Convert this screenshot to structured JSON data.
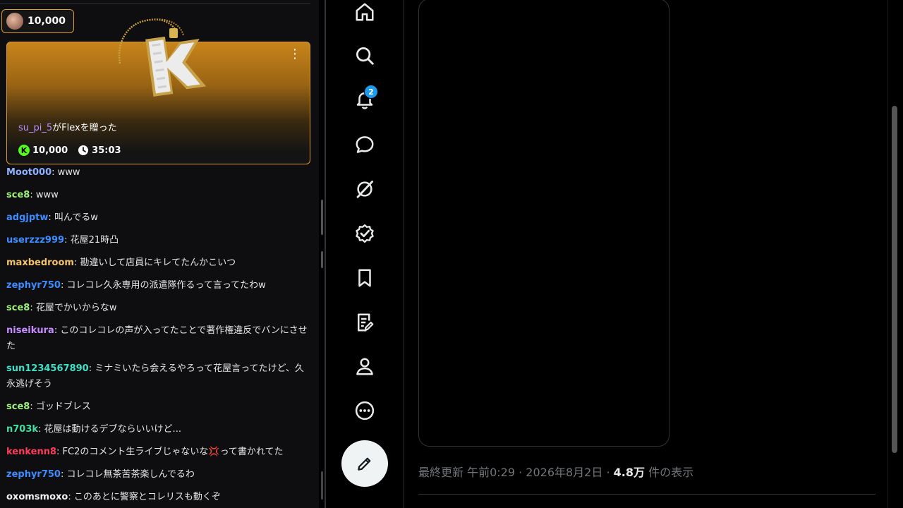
{
  "chat": {
    "gift_pill": {
      "amount": "10,000"
    },
    "flex_card": {
      "user": "su_pi_5",
      "message": "がFlexを贈った",
      "kick_amount": "10,000",
      "time_left": "35:03",
      "menu_glyph": "⋮"
    },
    "messages": [
      {
        "name": "Moot000",
        "text": ": www",
        "color": "#8fb1ff"
      },
      {
        "name": "sce8",
        "text": ": www",
        "color": "#9ef07a"
      },
      {
        "name": "adgjptw",
        "text": ": 叫んでるw",
        "color": "#3d8bff"
      },
      {
        "name": "userzzz999",
        "text": ": 花屋21時凸",
        "color": "#3d8bff"
      },
      {
        "name": "maxbedroom",
        "text": ": 勘違いして店員にキレてたんかこいつ",
        "color": "#f3c06a"
      },
      {
        "name": "zephyr750",
        "text": ": コレコレ久永専用の派遣隊作るって言ってたわw",
        "color": "#3d8bff"
      },
      {
        "name": "sce8",
        "text": ": 花屋でかいからなw",
        "color": "#9ef07a"
      },
      {
        "name": "niseikura",
        "text": ": このコレコレの声が入ってたことで著作権違反でバンにさせた",
        "color": "#c58cff"
      },
      {
        "name": "sun1234567890",
        "text": ": ミナミいたら会えるやろって花屋言ってたけど、久永逃げそう",
        "color": "#3fe0c5"
      },
      {
        "name": "sce8",
        "text": ": ゴッドブレス",
        "color": "#9ef07a"
      },
      {
        "name": "n703k",
        "text": ": 花屋は動けるデブならいいけど...",
        "color": "#3fe0a0"
      },
      {
        "name": "kenkenn8",
        "text": ": FC2のコメント生ライブじゃないな💢って書かれてた",
        "color": "#ff3b5c"
      },
      {
        "name": "zephyr750",
        "text": ": コレコレ無茶苦茶楽しんでるわ",
        "color": "#3d8bff"
      },
      {
        "name": "oxomsmoxo",
        "text": ": このあとに警察とコレリスも動くぞ",
        "color": "#f0f0f0"
      }
    ]
  },
  "sidebar": {
    "items": [
      {
        "icon": "home-icon"
      },
      {
        "icon": "search-icon"
      },
      {
        "icon": "bell-icon"
      },
      {
        "icon": "chat-bubble-icon"
      },
      {
        "icon": "grok-icon"
      },
      {
        "icon": "verified-icon"
      },
      {
        "icon": "bookmark-icon"
      },
      {
        "icon": "articles-icon"
      },
      {
        "icon": "profile-icon"
      },
      {
        "icon": "more-icon"
      }
    ],
    "notification_count": "2",
    "compose_icon": "compose-icon"
  },
  "post": {
    "meta_prefix": "最終更新 午前0:29 · 2026年8月2日 · ",
    "views": "4.8万",
    "views_suffix": " 件の表示"
  }
}
